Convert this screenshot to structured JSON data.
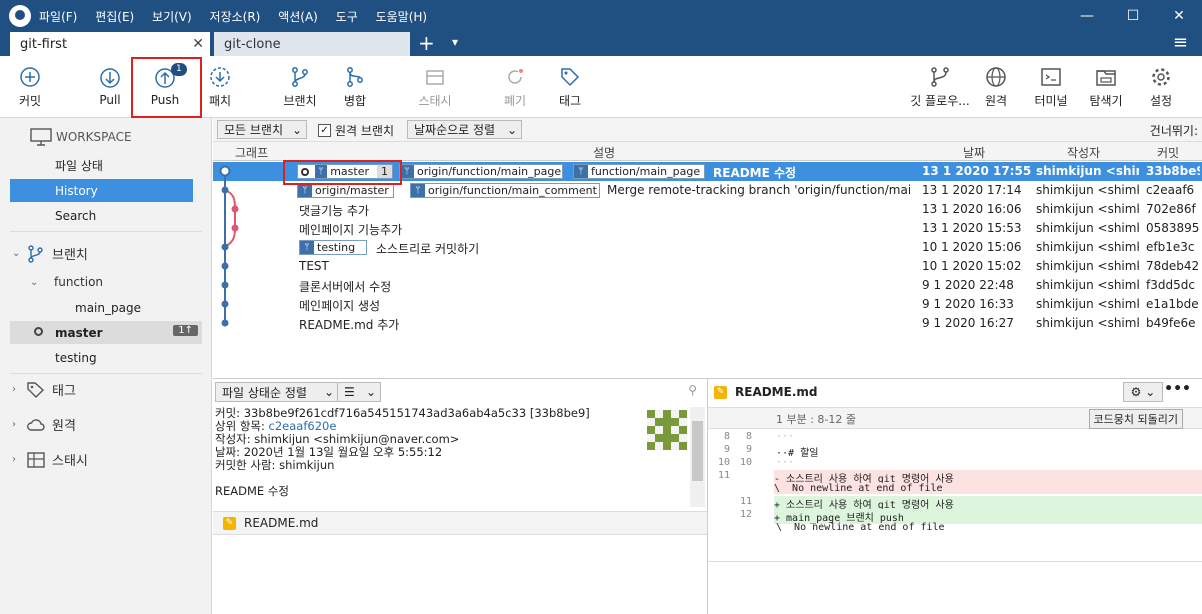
{
  "menu": [
    "파일(F)",
    "편집(E)",
    "보기(V)",
    "저장소(R)",
    "액션(A)",
    "도구",
    "도움말(H)"
  ],
  "window": {
    "minimize": "—",
    "maximize": "☐",
    "close": "✕"
  },
  "tabs": [
    {
      "label": "git-first",
      "close": "✕"
    },
    {
      "label": "git-clone"
    }
  ],
  "tab_add": "+",
  "tab_dropdown": "▾",
  "hamburger": "≡",
  "toolbar": {
    "commit": "커밋",
    "pull": "Pull",
    "push": "Push",
    "push_badge": "1",
    "patch": "패치",
    "branch": "브랜치",
    "merge": "병합",
    "stash": "스태시",
    "discard": "폐기",
    "tag": "태그",
    "gitflow": "깃 플로우...",
    "remote": "원격",
    "terminal": "터미널",
    "explorer": "탐색기",
    "settings": "설정"
  },
  "sidebar": {
    "workspace": "WORKSPACE",
    "file_status": "파일 상태",
    "history": "History",
    "search": "Search",
    "branches": "브랜치",
    "function": "function",
    "main_page": "main_page",
    "master": "master",
    "master_badge": "1↑",
    "testing": "testing",
    "tags": "태그",
    "remotes": "원격",
    "stashes": "스태시"
  },
  "filter": {
    "all_branches": "모든 브랜치",
    "remote_branches": "원격 브랜치",
    "sort": "날짜순으로 정렬",
    "jump": "건너뛰기:"
  },
  "columns": {
    "graph": "그래프",
    "desc": "설명",
    "date": "날짜",
    "author": "작성자",
    "commit": "커밋"
  },
  "commits": [
    {
      "desc": "README 수정",
      "date": "13 1 2020 17:55",
      "author": "shimkijun <shimk",
      "hash": "33b8be9"
    },
    {
      "desc": "Merge remote-tracking branch 'origin/function/main_co",
      "date": "13 1 2020 17:14",
      "author": "shimkijun <shimki",
      "hash": "c2eaaf6"
    },
    {
      "desc": "댓글기능 추가",
      "date": "13 1 2020 16:06",
      "author": "shimkijun <shimki",
      "hash": "702e86f"
    },
    {
      "desc": "메인페이지 기능추가",
      "date": "13 1 2020 15:53",
      "author": "shimkijun <shimki",
      "hash": "0583895"
    },
    {
      "desc": "소스트리로 커밋하기",
      "date": "10 1 2020 15:06",
      "author": "shimkijun <shimki",
      "hash": "efb1e3c"
    },
    {
      "desc": "TEST",
      "date": "10 1 2020 15:02",
      "author": "shimkijun <shimki",
      "hash": "78deb42"
    },
    {
      "desc": "클론서버에서 수정",
      "date": "9 1 2020 22:48",
      "author": "shimkijun <shimki",
      "hash": "f3dd5dc"
    },
    {
      "desc": "메인페이지 생성",
      "date": "9 1 2020 16:33",
      "author": "shimkijun <shimki",
      "hash": "e1a1bde"
    },
    {
      "desc": "README.md 추가",
      "date": "9 1 2020 16:27",
      "author": "shimkijun <shimki",
      "hash": "b49fe6e"
    }
  ],
  "refs": {
    "master": "master",
    "master_count": "1",
    "origin_main_page": "origin/function/main_page",
    "function_main_page": "function/main_page",
    "origin_master": "origin/master",
    "origin_main_comment": "origin/function/main_comment",
    "testing": "testing"
  },
  "details": {
    "sort_label": "파일 상태순 정렬",
    "commit_label": "커밋:",
    "commit_value": "33b8be9f261cdf716a545151743ad3a6ab4a5c33 [33b8be9]",
    "parent_label": "상위 항목:",
    "parent_value": "c2eaaf620e",
    "author_label": "작성자:",
    "author_value": "shimkijun <shimkijun@naver.com>",
    "date_label": "날짜:",
    "date_value": "2020년 1월 13일 월요일 오후 5:55:12",
    "committer_label": "커밋한 사람:",
    "committer_value": "shimkijun",
    "message": "README 수정",
    "file": "README.md"
  },
  "diff": {
    "file": "README.md",
    "hunk": "1 부분 : 8-12 줄",
    "revert_button": "코드뭉치 되돌리기",
    "lines": [
      {
        "o": "8",
        "n": "8",
        "t": "···",
        "k": "ctx"
      },
      {
        "o": "9",
        "n": "9",
        "t": "··# 할일",
        "k": "ctx"
      },
      {
        "o": "10",
        "n": "10",
        "t": "···",
        "k": "ctx"
      },
      {
        "o": "11",
        "n": "",
        "t": "- 소스트리 사용 하여 git 명령어 사용",
        "k": "del"
      },
      {
        "o": "",
        "n": "",
        "t": "\\  No newline at end of file",
        "k": "del"
      },
      {
        "o": "",
        "n": "11",
        "t": "+ 소스트리 사용 하여 git 명령어 사용",
        "k": "add"
      },
      {
        "o": "",
        "n": "12",
        "t": "+ main_page 브랜치 push",
        "k": "add"
      },
      {
        "o": "",
        "n": "",
        "t": "\\  No newline at end of file",
        "k": "ctx"
      }
    ]
  }
}
